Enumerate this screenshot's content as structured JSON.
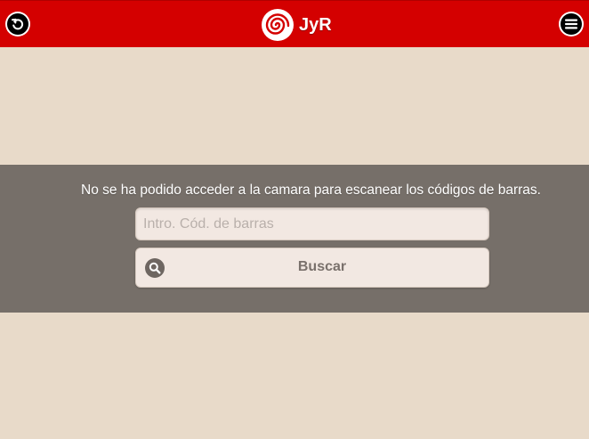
{
  "header": {
    "brand_name": "JyR",
    "back_icon": "back-icon",
    "menu_icon": "hamburger-menu-icon",
    "logo_icon": "spiral-logo-icon",
    "color": "#d40000"
  },
  "scanner": {
    "error_message": "No se ha podido acceder a la camara para escanear los códigos de barras.",
    "input_placeholder": "Intro. Cód. de barras",
    "input_value": "",
    "search_label": "Buscar",
    "search_icon": "search-icon"
  },
  "colors": {
    "background": "#e8dac9",
    "panel": "#766f69",
    "field": "#f2e8e2"
  }
}
